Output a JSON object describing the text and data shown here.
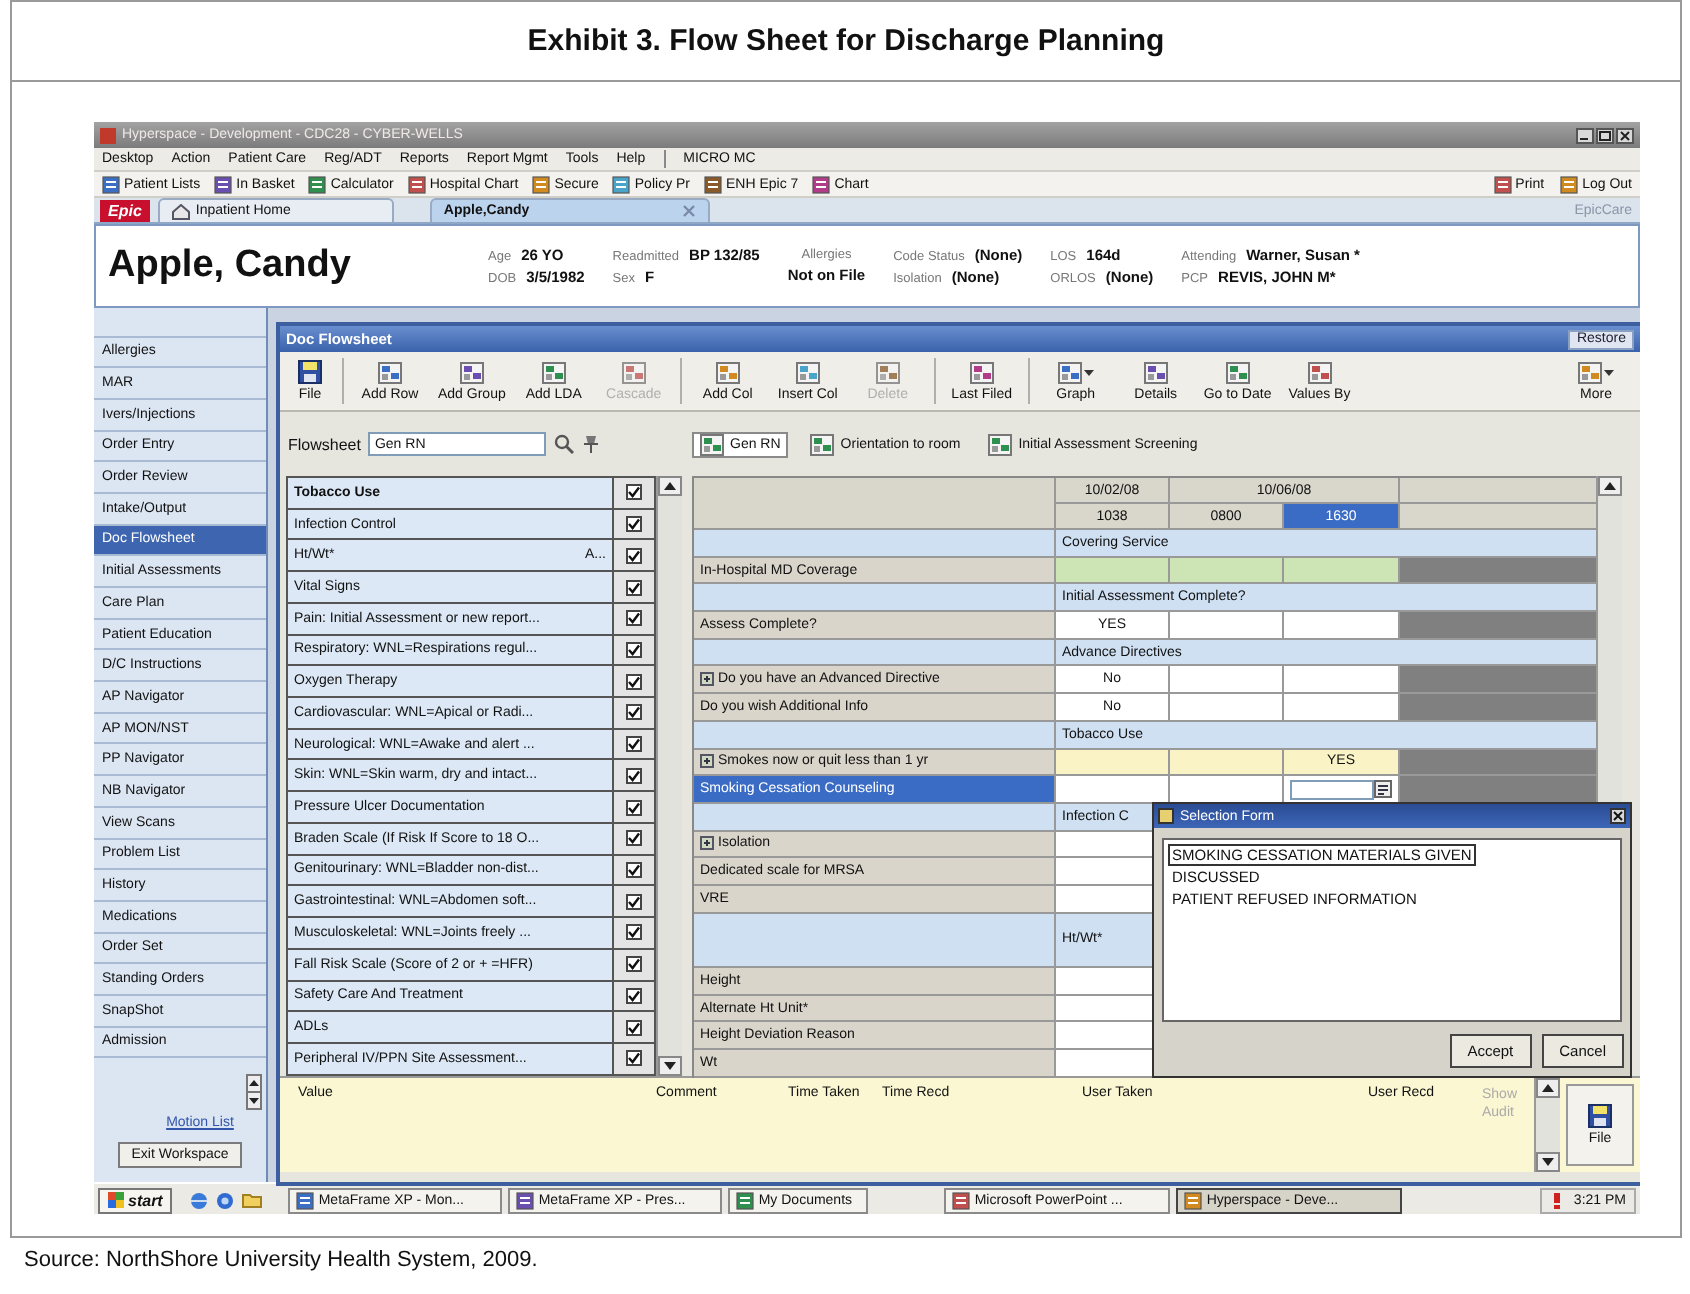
{
  "exhibit": {
    "title": "Exhibit 3. Flow Sheet for Discharge Planning",
    "source": "Source: NorthShore University Health System, 2009."
  },
  "window": {
    "title": "Hyperspace - Development - CDC28 - CYBER-WELLS"
  },
  "menu": [
    "Desktop",
    "Action",
    "Patient Care",
    "Reg/ADT",
    "Reports",
    "Report Mgmt",
    "Tools",
    "Help",
    "MICRO MC"
  ],
  "toolbar": [
    {
      "label": "Patient Lists"
    },
    {
      "label": "In Basket"
    },
    {
      "label": "Calculator"
    },
    {
      "label": "Hospital Chart"
    },
    {
      "label": "Secure"
    },
    {
      "label": "Policy Pr"
    },
    {
      "label": "ENH Epic 7"
    },
    {
      "label": "Chart"
    }
  ],
  "toolbar_right": [
    {
      "label": "Print"
    },
    {
      "label": "Log Out"
    }
  ],
  "logo": "Epic",
  "tabs": [
    {
      "label": "Inpatient Home",
      "selected": false
    },
    {
      "label": "Apple,Candy",
      "selected": true
    }
  ],
  "workspace": "EpicCare",
  "patient": {
    "name": "Apple, Candy",
    "columns": [
      {
        "rows": [
          {
            "label": "Age",
            "value": "26 YO"
          },
          {
            "label": "DOB",
            "value": "3/5/1982"
          }
        ]
      },
      {
        "rows": [
          {
            "label": "Readmitted",
            "value": "BP 132/85"
          },
          {
            "label": "Sex",
            "value": "F"
          }
        ]
      },
      {
        "rows": [
          {
            "label": "Allergies"
          },
          {
            "value": "Not on File"
          }
        ]
      },
      {
        "rows": [
          {
            "label": "Code Status",
            "value": "(None)"
          },
          {
            "label": "Isolation",
            "value": "(None)"
          }
        ]
      },
      {
        "rows": [
          {
            "label": "LOS",
            "value": "164d"
          },
          {
            "label": "ORLOS",
            "value": "(None)"
          }
        ]
      },
      {
        "rows": [
          {
            "label": "Attending",
            "value": "Warner, Susan *"
          },
          {
            "label": "PCP",
            "value": "REVIS, JOHN M*"
          }
        ]
      }
    ]
  },
  "sidebar": {
    "items": [
      {
        "label": "Allergies",
        "selected": false
      },
      {
        "label": "MAR",
        "selected": false
      },
      {
        "label": "Ivers/Injections",
        "selected": false
      },
      {
        "label": "Order Entry",
        "selected": false
      },
      {
        "label": "Order Review",
        "selected": false
      },
      {
        "label": "Intake/Output",
        "selected": false
      },
      {
        "label": "Doc Flowsheet",
        "selected": true
      },
      {
        "label": "Initial Assessments",
        "selected": false
      },
      {
        "label": "Care Plan",
        "selected": false
      },
      {
        "label": "Patient Education",
        "selected": false
      },
      {
        "label": "D/C Instructions",
        "selected": false
      },
      {
        "label": "AP Navigator",
        "selected": false
      },
      {
        "label": "AP MON/NST",
        "selected": false
      },
      {
        "label": "PP Navigator",
        "selected": false
      },
      {
        "label": "NB Navigator",
        "selected": false
      },
      {
        "label": "View Scans",
        "selected": false
      },
      {
        "label": "Problem List",
        "selected": false
      },
      {
        "label": "History",
        "selected": false
      },
      {
        "label": "Medications",
        "selected": false
      },
      {
        "label": "Order Set",
        "selected": false
      },
      {
        "label": "Standing Orders",
        "selected": false
      },
      {
        "label": "SnapShot",
        "selected": false
      },
      {
        "label": "Admission",
        "selected": false
      }
    ],
    "link": "Motion List",
    "button": "Exit Workspace"
  },
  "flowsheet": {
    "title": "Doc Flowsheet",
    "restore": "Restore",
    "file": "File",
    "toolbar": [
      [
        {
          "label": "Add Row",
          "disabled": false
        },
        {
          "label": "Add Group",
          "disabled": false
        },
        {
          "label": "Add LDA",
          "disabled": false
        },
        {
          "label": "Cascade",
          "disabled": true
        }
      ],
      [
        {
          "label": "Add Col",
          "disabled": false
        },
        {
          "label": "Insert Col",
          "disabled": false
        },
        {
          "label": "Delete",
          "disabled": true
        }
      ],
      [
        {
          "label": "Last Filed",
          "disabled": false
        }
      ],
      [
        {
          "label": "Graph",
          "disabled": false,
          "dropdown": true
        },
        {
          "label": "Details",
          "disabled": false
        },
        {
          "label": "Go to Date",
          "disabled": false
        },
        {
          "label": "Values By",
          "disabled": false
        }
      ]
    ],
    "more": {
      "label": "More",
      "dropdown": true
    },
    "label": "Flowsheet",
    "value": "Gen RN",
    "views": [
      {
        "label": "Gen RN",
        "selected": true
      },
      {
        "label": "Orientation to room",
        "selected": false
      },
      {
        "label": "Initial Assessment Screening",
        "selected": false
      }
    ],
    "groups": [
      {
        "label": "Tobacco Use",
        "checked": true
      },
      {
        "label": "Infection Control",
        "checked": true
      },
      {
        "label": "Ht/Wt*",
        "note": "A...",
        "checked": true
      },
      {
        "label": "Vital Signs",
        "checked": true
      },
      {
        "label": "Pain: Initial Assessment or new report...",
        "checked": true
      },
      {
        "label": "Respiratory: WNL=Respirations regul...",
        "checked": true
      },
      {
        "label": "Oxygen Therapy",
        "checked": true
      },
      {
        "label": "Cardiovascular: WNL=Apical or Radi...",
        "checked": true
      },
      {
        "label": "Neurological: WNL=Awake and alert ...",
        "checked": true
      },
      {
        "label": "Skin: WNL=Skin warm, dry and intact...",
        "checked": true
      },
      {
        "label": "Pressure Ulcer Documentation",
        "checked": true
      },
      {
        "label": "Braden Scale (If Risk If Score to 18 O...",
        "checked": true
      },
      {
        "label": "Genitourinary: WNL=Bladder non-dist...",
        "checked": true
      },
      {
        "label": "Gastrointestinal: WNL=Abdomen soft...",
        "checked": true
      },
      {
        "label": "Musculoskeletal: WNL=Joints freely ...",
        "checked": true
      },
      {
        "label": "Fall Risk Scale (Score of 2 or + =HFR)",
        "checked": true
      },
      {
        "label": "Safety Care And Treatment",
        "checked": true
      },
      {
        "label": "ADLs",
        "checked": true
      },
      {
        "label": "Peripheral IV/PPN Site Assessment...",
        "checked": true
      }
    ],
    "grid": {
      "dates": [
        {
          "label": "10/02/08"
        },
        {
          "label": "10/06/08",
          "wide": true
        }
      ],
      "times": [
        {
          "label": "1038",
          "selected": false
        },
        {
          "label": "0800",
          "selected": false
        },
        {
          "label": "1630",
          "selected": true
        }
      ],
      "rows": [
        {
          "kind": "group",
          "label": "Covering Service"
        },
        {
          "kind": "item",
          "label": "In-Hospital MD Coverage",
          "color": "#cde4b4",
          "selected": false
        },
        {
          "kind": "group",
          "label": "Initial Assessment Complete?"
        },
        {
          "kind": "item",
          "label": "Assess Complete?",
          "values": {
            "col1": "YES"
          },
          "selected": false
        },
        {
          "kind": "group",
          "label": "Advance Directives"
        },
        {
          "kind": "item",
          "label": "Do you have an Advanced Directive",
          "values": {
            "col1": "No"
          },
          "selected": false,
          "linked": true
        },
        {
          "kind": "item",
          "label": "Do you wish Additional Info",
          "values": {
            "col1": "No"
          },
          "selected": false
        },
        {
          "kind": "group",
          "label": "Tobacco Use"
        },
        {
          "kind": "item",
          "label": "Smokes now or quit less than 1 yr",
          "values": {
            "col3": "YES"
          },
          "color": "#f9f3c6",
          "selected": false,
          "linked": true
        },
        {
          "kind": "item",
          "label": "Smoking Cessation Counseling",
          "selected": true
        },
        {
          "kind": "group",
          "label": "Infection C"
        },
        {
          "kind": "item",
          "label": "Isolation",
          "selected": false,
          "linked": true
        },
        {
          "kind": "item",
          "label": "Dedicated scale for MRSA",
          "selected": false
        },
        {
          "kind": "item",
          "label": "VRE",
          "selected": false
        },
        {
          "kind": "tallgroup",
          "label": "Ht/Wt*"
        },
        {
          "kind": "item",
          "label": "Height",
          "selected": false
        },
        {
          "kind": "item",
          "label": "Alternate Ht Unit*",
          "selected": false
        },
        {
          "kind": "item",
          "label": "Height Deviation Reason",
          "selected": false
        },
        {
          "kind": "item",
          "label": "Wt",
          "selected": false
        }
      ]
    },
    "pane": {
      "columns": [
        "Value",
        "Comment",
        "Time Taken",
        "Time Recd",
        "User Taken",
        "User Recd",
        "Show Audit"
      ],
      "file": "File"
    },
    "popup": {
      "title": "Selection Form",
      "options": [
        {
          "label": "SMOKING CESSATION MATERIALS GIVEN",
          "selected": true
        },
        {
          "label": "DISCUSSED",
          "selected": false
        },
        {
          "label": "PATIENT REFUSED INFORMATION",
          "selected": false
        }
      ],
      "buttons": [
        "Accept",
        "Cancel"
      ]
    }
  },
  "taskbar": {
    "start": "start",
    "tasks": [
      {
        "label": "MetaFrame XP - Mon...",
        "selected": false
      },
      {
        "label": "MetaFrame XP - Pres...",
        "selected": false
      },
      {
        "label": "My Documents",
        "selected": false
      },
      {
        "label": "Microsoft PowerPoint ...",
        "selected": false
      },
      {
        "label": "Hyperspace - Deve...",
        "selected": true
      }
    ],
    "clock": "3:21 PM"
  }
}
